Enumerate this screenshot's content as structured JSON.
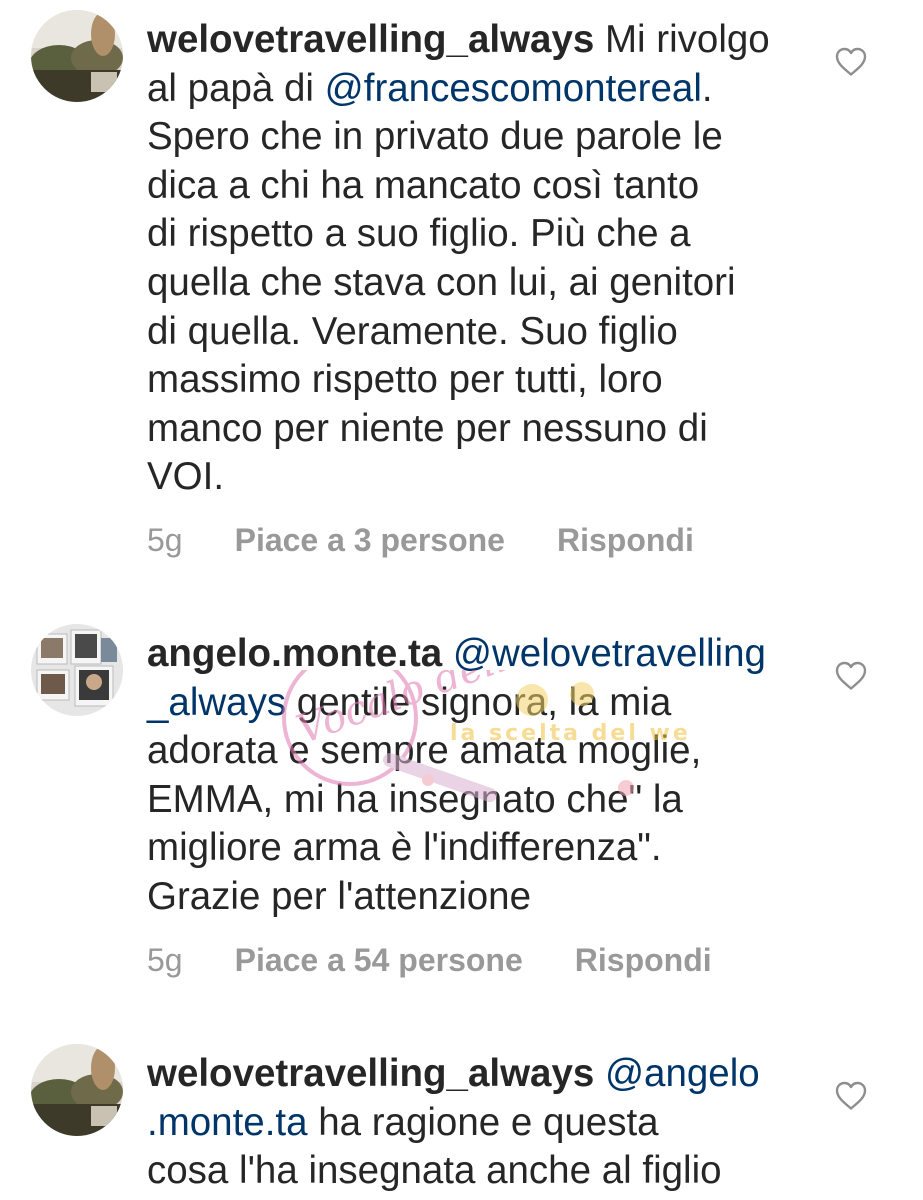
{
  "colors": {
    "text": "#262626",
    "mention": "#003569",
    "meta": "#999999",
    "heart_outline": "#8e8e8e"
  },
  "comments": [
    {
      "username": "welovetravelling_always",
      "text_before": " Mi rivolgo\nal papà di ",
      "mention": "@francescomontereal",
      "text_after": ".\nSpero che in privato due parole le\ndica a chi ha mancato così tanto\ndi rispetto a suo figlio. Più che a\nquella che stava con lui, ai genitori\ndi quella. Veramente. Suo figlio\nmassimo rispetto per tutti, loro\nmanco per niente per nessuno di\nVOI.",
      "time": "5g",
      "likes": "Piace a 3 persone",
      "reply": "Rispondi",
      "like_icon": "heart-outline-icon"
    },
    {
      "username": "angelo.monte.ta",
      "text_before": " ",
      "mention": "@welovetravelling\n_always",
      "text_after": " gentile signora, la mia\nadorata e sempre amata moglie,\nEMMA, mi ha insegnato che\" la\nmigliore arma è l'indifferenza\".\nGrazie per l'attenzione",
      "time": "5g",
      "likes": "Piace a 54 persone",
      "reply": "Rispondi",
      "like_icon": "heart-outline-icon"
    },
    {
      "username": "welovetravelling_always",
      "text_before": " ",
      "mention": "@angelo\n.monte.ta",
      "text_after": " ha ragione e questa\ncosa l'ha insegnata anche al figlio",
      "like_icon": "heart-outline-icon"
    }
  ],
  "watermark": {
    "script": "Vocalo delle",
    "tagline": "la scelta del web"
  }
}
